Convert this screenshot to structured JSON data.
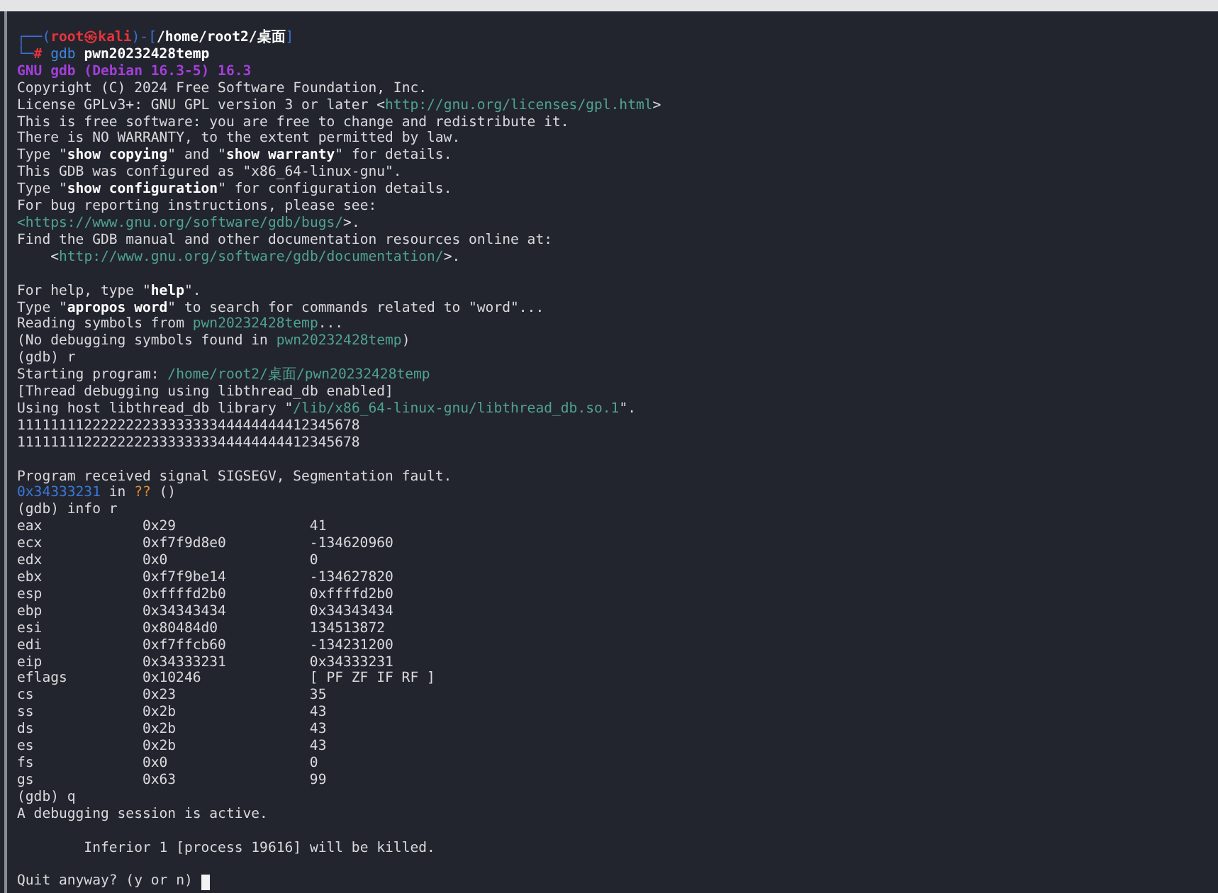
{
  "terminal": {
    "lines": [
      {
        "kind": "text",
        "segments": [
          {
            "text": "┌──(",
            "kind": "frame"
          },
          {
            "text": "root㉿kali",
            "kind": "user"
          },
          {
            "text": ")-[",
            "kind": "frame"
          },
          {
            "text": "/home/root2/桌面",
            "kind": "dir"
          },
          {
            "text": "]",
            "kind": "frame"
          }
        ]
      },
      {
        "kind": "text",
        "segments": [
          {
            "text": "└─",
            "kind": "frame"
          },
          {
            "text": "# ",
            "kind": "user"
          },
          {
            "text": "gdb ",
            "kind": "cmd"
          },
          {
            "text": "pwn20232428temp",
            "kind": "bold"
          }
        ]
      },
      {
        "kind": "text",
        "segments": [
          {
            "text": "GNU gdb (Debian 16.3-5) 16.3",
            "kind": "title"
          }
        ]
      },
      {
        "kind": "text",
        "segments": [
          {
            "text": "Copyright (C) 2024 Free Software Foundation, Inc.",
            "kind": "plain"
          }
        ]
      },
      {
        "kind": "text",
        "segments": [
          {
            "text": "License GPLv3+: GNU GPL version 3 or later <",
            "kind": "plain"
          },
          {
            "text": "http://gnu.org/licenses/gpl.html",
            "kind": "link"
          },
          {
            "text": ">",
            "kind": "plain"
          }
        ]
      },
      {
        "kind": "text",
        "segments": [
          {
            "text": "This is free software: you are free to change and redistribute it.",
            "kind": "plain"
          }
        ]
      },
      {
        "kind": "text",
        "segments": [
          {
            "text": "There is NO WARRANTY, to the extent permitted by law.",
            "kind": "plain"
          }
        ]
      },
      {
        "kind": "text",
        "segments": [
          {
            "text": "Type \"",
            "kind": "plain"
          },
          {
            "text": "show copying",
            "kind": "bold"
          },
          {
            "text": "\" and \"",
            "kind": "plain"
          },
          {
            "text": "show warranty",
            "kind": "bold"
          },
          {
            "text": "\" for details.",
            "kind": "plain"
          }
        ]
      },
      {
        "kind": "text",
        "segments": [
          {
            "text": "This GDB was configured as \"x86_64-linux-gnu\".",
            "kind": "plain"
          }
        ]
      },
      {
        "kind": "text",
        "segments": [
          {
            "text": "Type \"",
            "kind": "plain"
          },
          {
            "text": "show configuration",
            "kind": "bold"
          },
          {
            "text": "\" for configuration details.",
            "kind": "plain"
          }
        ]
      },
      {
        "kind": "text",
        "segments": [
          {
            "text": "For bug reporting instructions, please see:",
            "kind": "plain"
          }
        ]
      },
      {
        "kind": "text",
        "segments": [
          {
            "text": "<",
            "kind": "file"
          },
          {
            "text": "https://www.gnu.org/software/gdb/bugs/",
            "kind": "link"
          },
          {
            "text": ">.",
            "kind": "plain"
          }
        ]
      },
      {
        "kind": "text",
        "segments": [
          {
            "text": "Find the GDB manual and other documentation resources online at:",
            "kind": "plain"
          }
        ]
      },
      {
        "kind": "text",
        "segments": [
          {
            "text": "    <",
            "kind": "plain"
          },
          {
            "text": "http://www.gnu.org/software/gdb/documentation/",
            "kind": "link"
          },
          {
            "text": ">.",
            "kind": "plain"
          }
        ]
      },
      {
        "kind": "blank"
      },
      {
        "kind": "text",
        "segments": [
          {
            "text": "For help, type \"",
            "kind": "plain"
          },
          {
            "text": "help",
            "kind": "bold"
          },
          {
            "text": "\".",
            "kind": "plain"
          }
        ]
      },
      {
        "kind": "text",
        "segments": [
          {
            "text": "Type \"",
            "kind": "plain"
          },
          {
            "text": "apropos word",
            "kind": "bold"
          },
          {
            "text": "\" to search for commands related to \"word\"...",
            "kind": "plain"
          }
        ]
      },
      {
        "kind": "text",
        "segments": [
          {
            "text": "Reading symbols from ",
            "kind": "plain"
          },
          {
            "text": "pwn20232428temp",
            "kind": "file"
          },
          {
            "text": "...",
            "kind": "plain"
          }
        ]
      },
      {
        "kind": "text",
        "segments": [
          {
            "text": "(No debugging symbols found in ",
            "kind": "plain"
          },
          {
            "text": "pwn20232428temp",
            "kind": "file"
          },
          {
            "text": ")",
            "kind": "plain"
          }
        ]
      },
      {
        "kind": "text",
        "segments": [
          {
            "text": "(gdb) r",
            "kind": "plain"
          }
        ]
      },
      {
        "kind": "text",
        "segments": [
          {
            "text": "Starting program: ",
            "kind": "plain"
          },
          {
            "text": "/home/root2/桌面/pwn20232428temp",
            "kind": "file"
          }
        ]
      },
      {
        "kind": "text",
        "segments": [
          {
            "text": "[Thread debugging using libthread_db enabled]",
            "kind": "plain"
          }
        ]
      },
      {
        "kind": "text",
        "segments": [
          {
            "text": "Using host libthread_db library \"",
            "kind": "plain"
          },
          {
            "text": "/lib/x86_64-linux-gnu/libthread_db.so.1",
            "kind": "file"
          },
          {
            "text": "\".",
            "kind": "plain"
          }
        ]
      },
      {
        "kind": "text",
        "segments": [
          {
            "text": "11111111222222223333333344444444412345678",
            "kind": "plain"
          }
        ]
      },
      {
        "kind": "text",
        "segments": [
          {
            "text": "11111111222222223333333344444444412345678",
            "kind": "plain"
          }
        ]
      },
      {
        "kind": "blank"
      },
      {
        "kind": "text",
        "segments": [
          {
            "text": "Program received signal SIGSEGV, Segmentation fault.",
            "kind": "plain"
          }
        ]
      },
      {
        "kind": "text",
        "segments": [
          {
            "text": "0x34333231",
            "kind": "address"
          },
          {
            "text": " in ",
            "kind": "plain"
          },
          {
            "text": "??",
            "kind": "unknown"
          },
          {
            "text": " ()",
            "kind": "plain"
          }
        ]
      },
      {
        "kind": "text",
        "segments": [
          {
            "text": "(gdb) info r",
            "kind": "plain"
          }
        ]
      },
      {
        "kind": "register",
        "name": "eax",
        "hex": "0x29",
        "value": "41"
      },
      {
        "kind": "register",
        "name": "ecx",
        "hex": "0xf7f9d8e0",
        "value": "-134620960"
      },
      {
        "kind": "register",
        "name": "edx",
        "hex": "0x0",
        "value": "0"
      },
      {
        "kind": "register",
        "name": "ebx",
        "hex": "0xf7f9be14",
        "value": "-134627820"
      },
      {
        "kind": "register",
        "name": "esp",
        "hex": "0xffffd2b0",
        "value": "0xffffd2b0"
      },
      {
        "kind": "register",
        "name": "ebp",
        "hex": "0x34343434",
        "value": "0x34343434"
      },
      {
        "kind": "register",
        "name": "esi",
        "hex": "0x80484d0",
        "value": "134513872"
      },
      {
        "kind": "register",
        "name": "edi",
        "hex": "0xf7ffcb60",
        "value": "-134231200"
      },
      {
        "kind": "register",
        "name": "eip",
        "hex": "0x34333231",
        "value": "0x34333231"
      },
      {
        "kind": "register",
        "name": "eflags",
        "hex": "0x10246",
        "value": "[ PF ZF IF RF ]"
      },
      {
        "kind": "register",
        "name": "cs",
        "hex": "0x23",
        "value": "35"
      },
      {
        "kind": "register",
        "name": "ss",
        "hex": "0x2b",
        "value": "43"
      },
      {
        "kind": "register",
        "name": "ds",
        "hex": "0x2b",
        "value": "43"
      },
      {
        "kind": "register",
        "name": "es",
        "hex": "0x2b",
        "value": "43"
      },
      {
        "kind": "register",
        "name": "fs",
        "hex": "0x0",
        "value": "0"
      },
      {
        "kind": "register",
        "name": "gs",
        "hex": "0x63",
        "value": "99"
      },
      {
        "kind": "text",
        "segments": [
          {
            "text": "(gdb) q",
            "kind": "plain"
          }
        ]
      },
      {
        "kind": "text",
        "segments": [
          {
            "text": "A debugging session is active.",
            "kind": "plain"
          }
        ]
      },
      {
        "kind": "blank"
      },
      {
        "kind": "text",
        "segments": [
          {
            "text": "        Inferior 1 [process 19616] will be killed.",
            "kind": "plain"
          }
        ]
      },
      {
        "kind": "blank"
      },
      {
        "kind": "text",
        "cursor": true,
        "segments": [
          {
            "text": "Quit anyway? (y or n) ",
            "kind": "plain"
          }
        ]
      }
    ]
  }
}
